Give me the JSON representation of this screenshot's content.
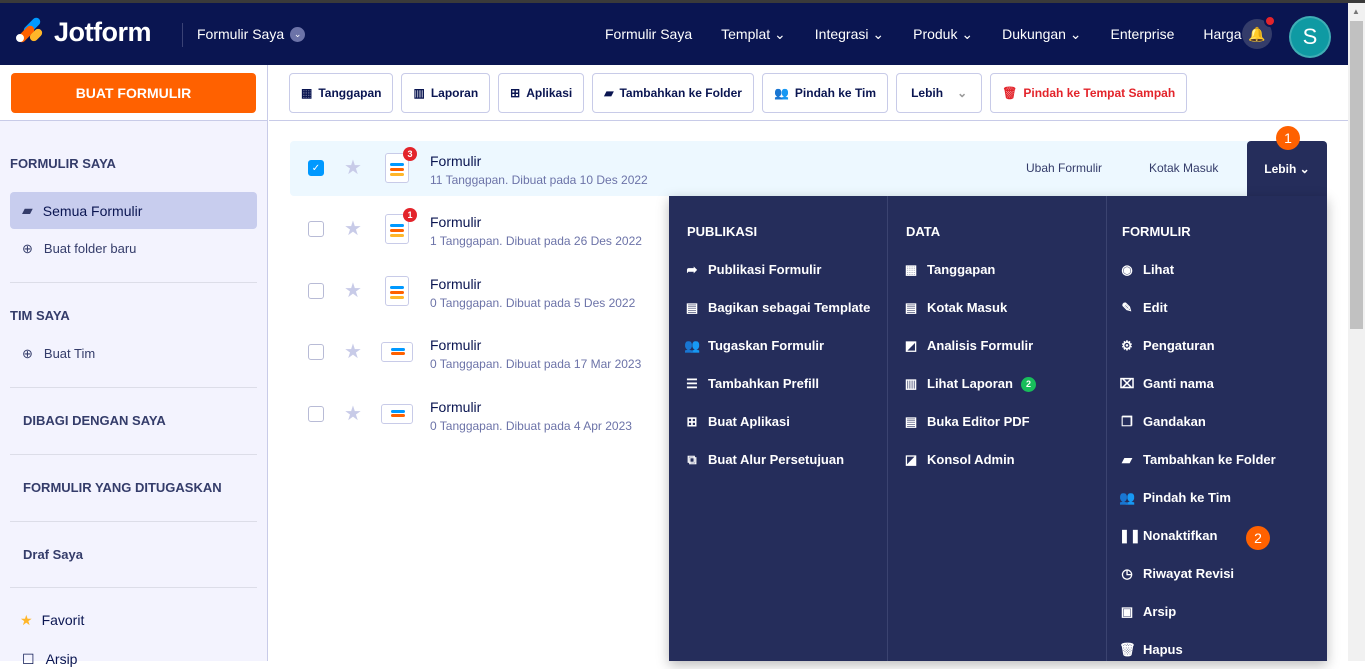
{
  "header": {
    "brand": "Jotform",
    "my_forms": "Formulir Saya",
    "nav": [
      "Formulir Saya",
      "Templat ⌄",
      "Integrasi ⌄",
      "Produk ⌄",
      "Dukungan ⌄",
      "Enterprise",
      "Harga"
    ],
    "avatar_letter": "S"
  },
  "sidebar": {
    "create_button": "BUAT FORMULIR",
    "my_forms_heading": "FORMULIR SAYA",
    "all_forms": "Semua Formulir",
    "new_folder": "Buat folder baru",
    "my_team_heading": "TIM SAYA",
    "create_team": "Buat Tim",
    "shared": "DIBAGI DENGAN SAYA",
    "assigned": "FORMULIR YANG DITUGASKAN",
    "drafts": "Draf Saya",
    "favorites": "Favorit",
    "archive": "Arsip"
  },
  "toolbar": {
    "responses": "Tanggapan",
    "reports": "Laporan",
    "apps": "Aplikasi",
    "add_folder": "Tambahkan ke Folder",
    "move_team": "Pindah ke Tim",
    "more": "Lebih",
    "trash": "Pindah ke Tempat Sampah"
  },
  "forms": [
    {
      "title": "Formulir",
      "meta": "11 Tanggapan. Dibuat pada 10 Des 2022",
      "badge": "3",
      "selected": true,
      "icon": "tall"
    },
    {
      "title": "Formulir",
      "meta": "1 Tanggapan. Dibuat pada 26 Des 2022",
      "badge": "1",
      "selected": false,
      "icon": "tall"
    },
    {
      "title": "Formulir",
      "meta": "0 Tanggapan. Dibuat pada 5 Des 2022",
      "badge": null,
      "selected": false,
      "icon": "tall"
    },
    {
      "title": "Formulir",
      "meta": "0 Tanggapan. Dibuat pada 17 Mar 2023",
      "badge": null,
      "selected": false,
      "icon": "wide"
    },
    {
      "title": "Formulir",
      "meta": "0 Tanggapan. Dibuat pada 4 Apr 2023",
      "badge": null,
      "selected": false,
      "icon": "wide"
    }
  ],
  "row_actions": {
    "edit": "Ubah Formulir",
    "inbox": "Kotak Masuk",
    "more": "Lebih ⌄"
  },
  "steps": [
    "1",
    "2"
  ],
  "menu": [
    {
      "heading": "PUBLIKASI",
      "items": [
        {
          "icon": "share",
          "glyph": "➦",
          "label": "Publikasi Formulir"
        },
        {
          "icon": "template",
          "glyph": "▤",
          "label": "Bagikan sebagai Template"
        },
        {
          "icon": "assign",
          "glyph": "👥",
          "label": "Tugaskan Formulir"
        },
        {
          "icon": "prefill",
          "glyph": "☰",
          "label": "Tambahkan Prefill"
        },
        {
          "icon": "app",
          "glyph": "⊞",
          "label": "Buat Aplikasi"
        },
        {
          "icon": "approval",
          "glyph": "⧉",
          "label": "Buat Alur Persetujuan"
        }
      ]
    },
    {
      "heading": "DATA",
      "items": [
        {
          "icon": "table",
          "glyph": "▦",
          "label": "Tanggapan"
        },
        {
          "icon": "inbox",
          "glyph": "▤",
          "label": "Kotak Masuk"
        },
        {
          "icon": "analytics",
          "glyph": "◩",
          "label": "Analisis Formulir"
        },
        {
          "icon": "report",
          "glyph": "▥",
          "label": "Lihat Laporan",
          "badge": "2"
        },
        {
          "icon": "pdf",
          "glyph": "▤",
          "label": "Buka Editor PDF"
        },
        {
          "icon": "admin",
          "glyph": "◪",
          "label": "Konsol Admin"
        }
      ]
    },
    {
      "heading": "FORMULIR",
      "items": [
        {
          "icon": "eye",
          "glyph": "◉",
          "label": "Lihat"
        },
        {
          "icon": "edit",
          "glyph": "✎",
          "label": "Edit"
        },
        {
          "icon": "gear",
          "glyph": "⚙",
          "label": "Pengaturan"
        },
        {
          "icon": "rename",
          "glyph": "⌧",
          "label": "Ganti nama"
        },
        {
          "icon": "clone",
          "glyph": "❐",
          "label": "Gandakan"
        },
        {
          "icon": "folder-add",
          "glyph": "▰",
          "label": "Tambahkan ke Folder"
        },
        {
          "icon": "team",
          "glyph": "👥",
          "label": "Pindah ke Tim"
        },
        {
          "icon": "pause",
          "glyph": "❚❚",
          "label": "Nonaktifkan"
        },
        {
          "icon": "history",
          "glyph": "◷",
          "label": "Riwayat Revisi"
        },
        {
          "icon": "archive",
          "glyph": "▣",
          "label": "Arsip"
        },
        {
          "icon": "trash",
          "glyph": "🗑",
          "label": "Hapus"
        }
      ]
    }
  ],
  "colors": {
    "nav": "#0a1551",
    "accent": "#ff6100",
    "menu": "#252d5b",
    "danger": "#e3242b",
    "check": "#0099ff"
  }
}
